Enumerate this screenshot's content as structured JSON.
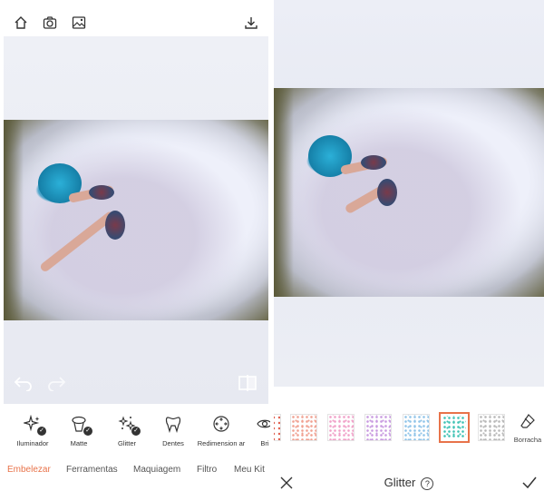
{
  "left": {
    "topbar": {
      "icons": [
        "home-icon",
        "camera-icon",
        "gallery-icon",
        "download-icon"
      ]
    },
    "tools": [
      {
        "label": "Iluminador",
        "icon": "sparkle-icon",
        "checked": true
      },
      {
        "label": "Matte",
        "icon": "matte-icon",
        "checked": true
      },
      {
        "label": "Glitter",
        "icon": "glitter-icon",
        "checked": true
      },
      {
        "label": "Dentes",
        "icon": "tooth-icon",
        "checked": false
      },
      {
        "label": "Redimension ar",
        "icon": "resize-icon",
        "checked": false
      },
      {
        "label": "Bri",
        "icon": "eye-icon",
        "checked": false
      }
    ],
    "tabs": [
      {
        "label": "Embelezar",
        "active": true
      },
      {
        "label": "Ferramentas",
        "active": false
      },
      {
        "label": "Maquiagem",
        "active": false
      },
      {
        "label": "Filtro",
        "active": false
      },
      {
        "label": "Meu Kit",
        "active": false
      }
    ]
  },
  "right": {
    "patterns": [
      {
        "color": "#f0a090",
        "selected": false
      },
      {
        "color": "#f0a0c8",
        "selected": false
      },
      {
        "color": "#c89ae0",
        "selected": false
      },
      {
        "color": "#90c4e8",
        "selected": false
      },
      {
        "color": "#3fc2b4",
        "selected": true
      },
      {
        "color": "#b8b8b8",
        "selected": false
      }
    ],
    "eraser_label": "Borracha",
    "footer": {
      "title": "Glitter",
      "help": "?"
    }
  },
  "colors": {
    "accent": "#e8734a",
    "text": "#333333"
  }
}
